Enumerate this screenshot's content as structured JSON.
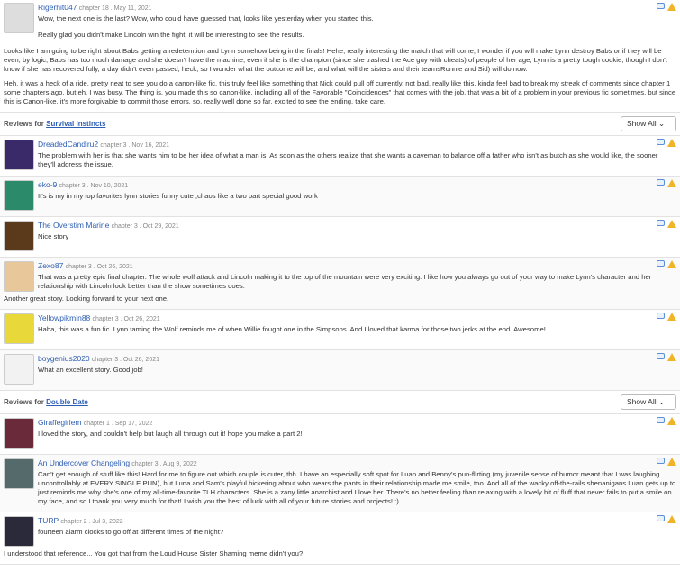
{
  "top_review": {
    "author": "Rigerhit047",
    "meta": "chapter 18 . May 11, 2021",
    "lines": [
      "Wow, the next one is the last? Wow, who could have guessed that, looks like yesterday when you started this.",
      "Really glad you didn't make Lincoln win the fight, it will be interesting to see the results."
    ],
    "paras": [
      "Looks like I am going to be right about Babs getting a redetemtion and Lynn somehow being in the finals! Hehe, really interesting the match that will come, I wonder if you will make Lynn destroy Babs or if they will be even, by logic, Babs has too much damage and she doesn't have the machine, even if she is the champion (since she trashed the Ace guy with cheats) of people of her age, Lynn is a pretty tough cookie, though I don't know if she has recovered fully, a day didn't even passed, heck, so I wonder what the outcome will be, and what will the sisters and their teamsRonnie and Sid) will do now.",
      "Heh, it was a heck of a ride, pretty neat to see you do a canon-like fic, this truly feel like something that Nick could pull off currently, not bad, really like this, kinda feel bad to break my streak of comments since chapter 1 some chapters ago, but eh, I was busy. The thing is, you made this so canon-like, including all of the Favorable \"Coincidences\" that comes with the job, that was a bit of a problem in your previous fic sometimes, but since this is Canon-like, it's more forgivable to commit those errors, so, really well done so far, excited to see the ending, take care."
    ]
  },
  "section1": {
    "prefix": "Reviews for",
    "story": "Survival Instincts",
    "select": "Show All"
  },
  "reviews1": [
    {
      "author": "DreadedCandiru2",
      "meta": "chapter 3 . Nov 16, 2021",
      "text": "The problem with her is that she wants him to be her idea of what a man is. As soon as the others realize that she wants a caveman to balance off a father who isn't as butch as she would like, the sooner they'll address the issue.",
      "color": "#3a2a6a"
    },
    {
      "author": "eko-9",
      "meta": "chapter 3 . Nov 10, 2021",
      "text": "It's is my in my top favorites lynn stories funny cute ,chaos like a two part special good work",
      "color": "#2a8a6a"
    },
    {
      "author": "The Overstim Marine",
      "meta": "chapter 3 . Oct 29, 2021",
      "text": "Nice story",
      "color": "#5a3a1a"
    },
    {
      "author": "Zexo87",
      "meta": "chapter 3 . Oct 26, 2021",
      "text": "That was a pretty epic final chapter. The whole wolf attack and Lincoln making it to the top of the mountain were very exciting. I like how you always go out of your way to make Lynn's character and her relationship with Lincoln look better than the show sometimes does.",
      "extra": "Another great story. Looking forward to your next one.",
      "color": "#e8c89a"
    },
    {
      "author": "Yellowpikmin88",
      "meta": "chapter 3 . Oct 26, 2021",
      "text": "Haha, this was a fun fic. Lynn taming the Wolf reminds me of when Willie fought one in the Simpsons. And I loved that karma for those two jerks at the end. Awesome!",
      "color": "#e8d83a"
    },
    {
      "author": "boygenius2020",
      "meta": "chapter 3 . Oct 26, 2021",
      "text": "What an excellent story. Good job!",
      "color": "#f2f2f2"
    }
  ],
  "section2": {
    "prefix": "Reviews for",
    "story": "Double Date",
    "select": "Show All"
  },
  "reviews2": [
    {
      "author": "Giraffegirlem",
      "meta": "chapter 1 . Sep 17, 2022",
      "text": "I loved the story, and couldn't help but laugh all through out it! hope you make a part 2!",
      "color": "#6a2a3a"
    },
    {
      "author": "An Undercover Changeling",
      "meta": "chapter 3 . Aug 9, 2022",
      "text": "Can't get enough of stuff like this! Hard for me to figure out which couple is cuter, tbh. I have an especially soft spot for Luan and Benny's pun-flirting (my juvenile sense of humor meant that I was laughing uncontrollably at EVERY SINGLE PUN), but Luna and Sam's playful bickering about who wears the pants in their relationship made me smile, too. And all of the wacky off-the-rails shenanigans Luan gets up to just reminds me why she's one of my all-time-favorite TLH characters. She is a zany little anarchist and I love her. There's no better feeling than relaxing with a lovely bit of fluff that never fails to put a smile on my face, and so I thank you very much for that! I wish you the best of luck with all of your future stories and projects! :)",
      "color": "#556a6a"
    },
    {
      "author": "TURP",
      "meta": "chapter 2 . Jul 3, 2022",
      "text": "fourteen alarm clocks to go off at different times of the night?",
      "extra": "I understood that reference... You got that from the Loud House Sister Shaming meme didn't you?",
      "color": "#2a2a3a"
    }
  ]
}
